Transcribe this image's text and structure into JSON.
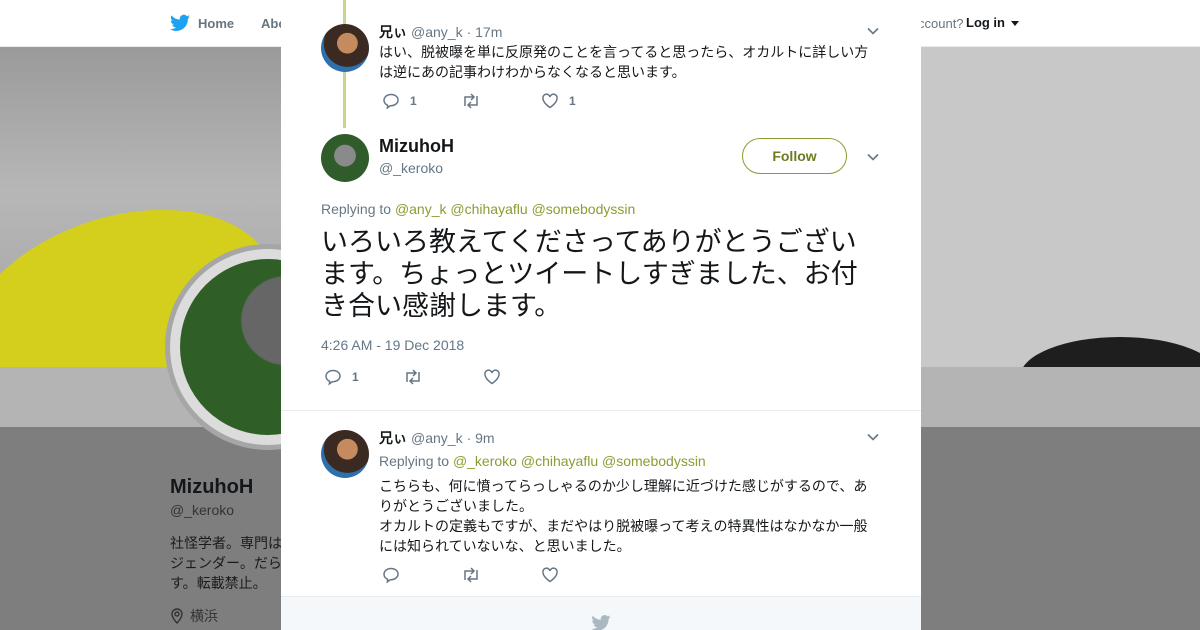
{
  "background_page": {
    "nav": {
      "home_label": "Home",
      "about_label": "Abo",
      "account_text": "ccount?",
      "login_label": "Log in"
    },
    "profile": {
      "name": "MizuhoH",
      "handle": "@_keroko",
      "bio": "社怪学者。専門はジェンダー。だらす。転載禁止。",
      "location": "横浜"
    }
  },
  "modal": {
    "parent_tweet": {
      "name": "兄ぃ",
      "handle": "@any_k",
      "time": "· 17m",
      "text": "はい、脱被曝を単に反原発のことを言ってると思ったら、オカルトに詳しい方は逆にあの記事わけわからなくなると思います。",
      "reply_count": "1",
      "retweet_count": "",
      "like_count": "1"
    },
    "main_tweet": {
      "name": "MizuhoH",
      "handle": "@_keroko",
      "follow_label": "Follow",
      "replying_prefix": "Replying to",
      "mentions": [
        "@any_k",
        "@chihayaflu",
        "@somebodyssin"
      ],
      "text": "いろいろ教えてくださってありがとうございます。ちょっとツイートしすぎました、お付き合い感謝します。",
      "timestamp": "4:26 AM - 19 Dec 2018",
      "reply_count": "1",
      "retweet_count": "",
      "like_count": ""
    },
    "reply_tweet": {
      "name": "兄ぃ",
      "handle": "@any_k",
      "time": "· 9m",
      "replying_prefix": "Replying to",
      "mentions": [
        "@_keroko",
        "@chihayaflu",
        "@somebodyssin"
      ],
      "text_line1": "こちらも、何に憤ってらっしゃるのか少し理解に近づけた感じがするので、ありがとうございました。",
      "text_line2": "オカルトの定義もですが、まだやはり脱被曝って考えの特異性はなかなか一般には知られていないな、と思いました。",
      "reply_count": "",
      "retweet_count": "",
      "like_count": ""
    }
  },
  "icons": [
    "twitter-bird-icon",
    "close-icon",
    "chevron-down-icon",
    "reply-icon",
    "retweet-icon",
    "like-icon",
    "location-pin-icon"
  ],
  "colors": {
    "accent": "#8b9c32",
    "thread_line": "#c5d68e",
    "twitter_blue": "#1da1f2",
    "muted": "#657786"
  }
}
